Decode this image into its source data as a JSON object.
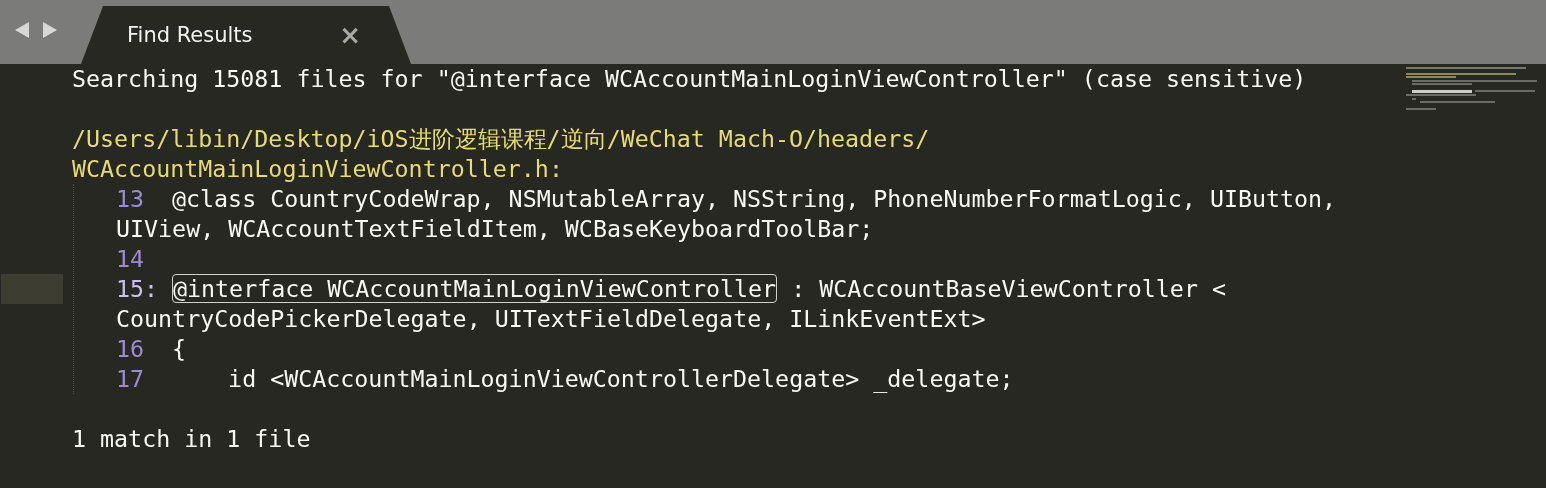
{
  "tab": {
    "label": "Find Results",
    "close": "×",
    "selected": true
  },
  "search_header": "Searching 15081 files for \"@interface WCAccountMainLoginViewController\" (case sensitive)",
  "path_lines": [
    "/Users/libin/Desktop/iOS进阶逻辑课程/逆向/WeChat Mach-O/headers/",
    "WCAccountMainLoginViewController.h:"
  ],
  "results": [
    {
      "number": "13",
      "kind": "context",
      "text": "@class CountryCodeWrap, NSMutableArray, NSString, PhoneNumberFormatLogic, UIButton,",
      "continuation": "UIView, WCAccountTextFieldItem, WCBaseKeyboardToolBar;"
    },
    {
      "number": "14",
      "kind": "context"
    },
    {
      "number": "15",
      "kind": "match",
      "separator": ":",
      "match": "@interface WCAccountMainLoginViewController",
      "text": " : WCAccountBaseViewController <",
      "continuation": "CountryCodePickerDelegate, UITextFieldDelegate, ILinkEventExt>"
    },
    {
      "number": "16",
      "kind": "context",
      "text": "{"
    },
    {
      "number": "17",
      "kind": "context",
      "text": "    id <WCAccountMainLoginViewControllerDelegate> _delegate;"
    }
  ],
  "summary": "1 match in 1 file"
}
